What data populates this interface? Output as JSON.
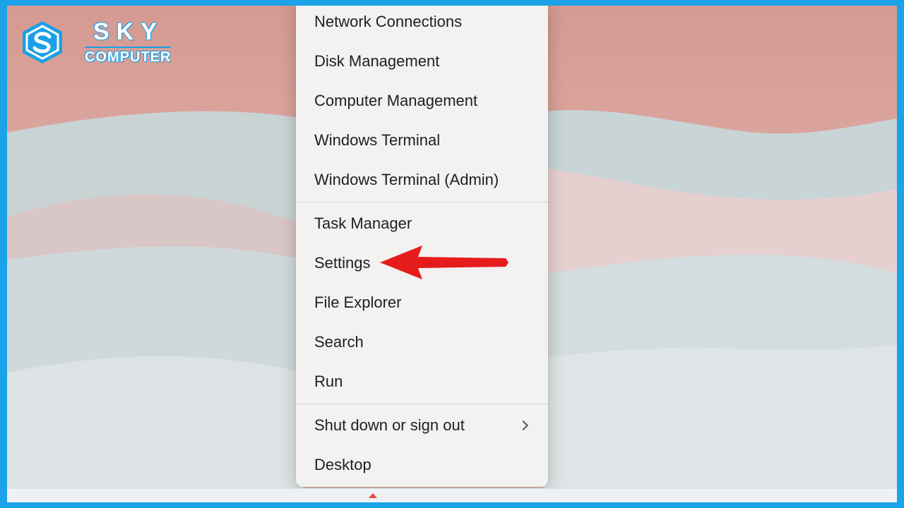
{
  "brand": {
    "name_line1": "SKY",
    "name_line2": "COMPUTER",
    "color": "#19a0e6"
  },
  "menu": {
    "items": [
      {
        "label": "Network Connections"
      },
      {
        "label": "Disk Management"
      },
      {
        "label": "Computer Management"
      },
      {
        "label": "Windows Terminal"
      },
      {
        "label": "Windows Terminal (Admin)"
      },
      {
        "label": "Task Manager"
      },
      {
        "label": "Settings",
        "highlighted_by_arrow": true
      },
      {
        "label": "File Explorer"
      },
      {
        "label": "Search"
      },
      {
        "label": "Run"
      },
      {
        "label": "Shut down or sign out",
        "submenu_icon": "chevron-right-icon"
      },
      {
        "label": "Desktop"
      }
    ]
  },
  "annotation": {
    "arrow_color": "#e61c1c",
    "arrow_target": "Settings"
  },
  "colors": {
    "frame_border": "#1aa3e8",
    "menu_background": "#f4f1f1"
  }
}
